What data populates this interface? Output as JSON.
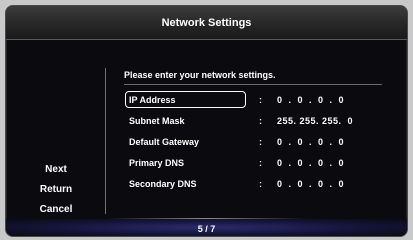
{
  "window": {
    "title": "Network Settings"
  },
  "side_menu": {
    "items": [
      {
        "label": "Next"
      },
      {
        "label": "Return"
      },
      {
        "label": "Cancel"
      }
    ]
  },
  "form": {
    "prompt": "Please enter your network settings.",
    "fields": [
      {
        "label": "IP Address",
        "colon": ":",
        "value": "0  .  0  .  0  .  0",
        "focused": true
      },
      {
        "label": "Subnet Mask",
        "colon": ":",
        "value": "255. 255. 255.  0",
        "focused": false
      },
      {
        "label": "Default Gateway",
        "colon": ":",
        "value": "0  .  0  .  0  .  0",
        "focused": false
      },
      {
        "label": "Primary DNS",
        "colon": ":",
        "value": "0  .  0  .  0  .  0",
        "focused": false
      },
      {
        "label": "Secondary DNS",
        "colon": ":",
        "value": "0  .  0  .  0  .  0",
        "focused": false
      }
    ]
  },
  "pagination": {
    "text": "5 / 7"
  },
  "colors": {
    "background": "#0b0b0f",
    "page_bar": "#2b2b6a",
    "text": "#ffffff"
  }
}
